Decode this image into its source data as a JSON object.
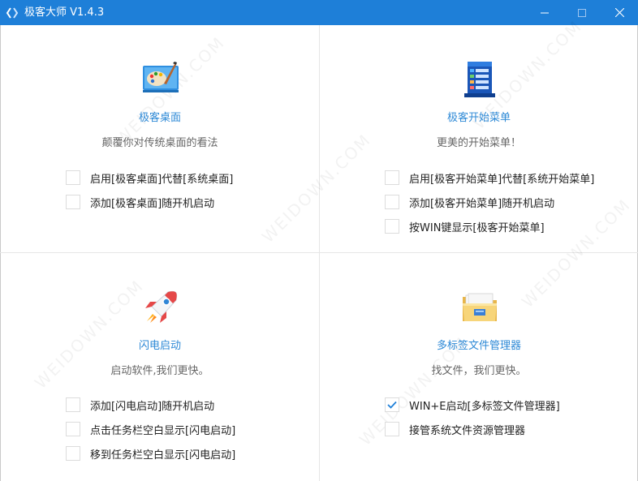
{
  "window": {
    "title": "极客大师 V1.4.3"
  },
  "colors": {
    "titlebar": "#1e7fd8",
    "accent": "#2d89d6",
    "check": "#1e7fd8"
  },
  "panels": [
    {
      "title": "极客桌面",
      "description": "颠覆你对传统桌面的看法",
      "icon": "palette-icon",
      "options": [
        {
          "label": "启用[极客桌面]代替[系统桌面]",
          "checked": false
        },
        {
          "label": "添加[极客桌面]随开机启动",
          "checked": false
        }
      ]
    },
    {
      "title": "极客开始菜单",
      "description": "更美的开始菜单！",
      "icon": "start-menu-icon",
      "options": [
        {
          "label": "启用[极客开始菜单]代替[系统开始菜单]",
          "checked": false
        },
        {
          "label": "添加[极客开始菜单]随开机启动",
          "checked": false
        },
        {
          "label": "按WIN键显示[极客开始菜单]",
          "checked": false
        }
      ]
    },
    {
      "title": "闪电启动",
      "description": "启动软件,我们更快。",
      "icon": "rocket-icon",
      "options": [
        {
          "label": "添加[闪电启动]随开机启动",
          "checked": false
        },
        {
          "label": "点击任务栏空白显示[闪电启动]",
          "checked": false
        },
        {
          "label": "移到任务栏空白显示[闪电启动]",
          "checked": false
        }
      ]
    },
    {
      "title": "多标签文件管理器",
      "description": "找文件，我们更快。",
      "icon": "folder-icon",
      "options": [
        {
          "label": "WIN+E启动[多标签文件管理器]",
          "checked": true
        },
        {
          "label": "接管系统文件资源管理器",
          "checked": false
        }
      ]
    }
  ],
  "watermark": "WEIDOWN.COM"
}
